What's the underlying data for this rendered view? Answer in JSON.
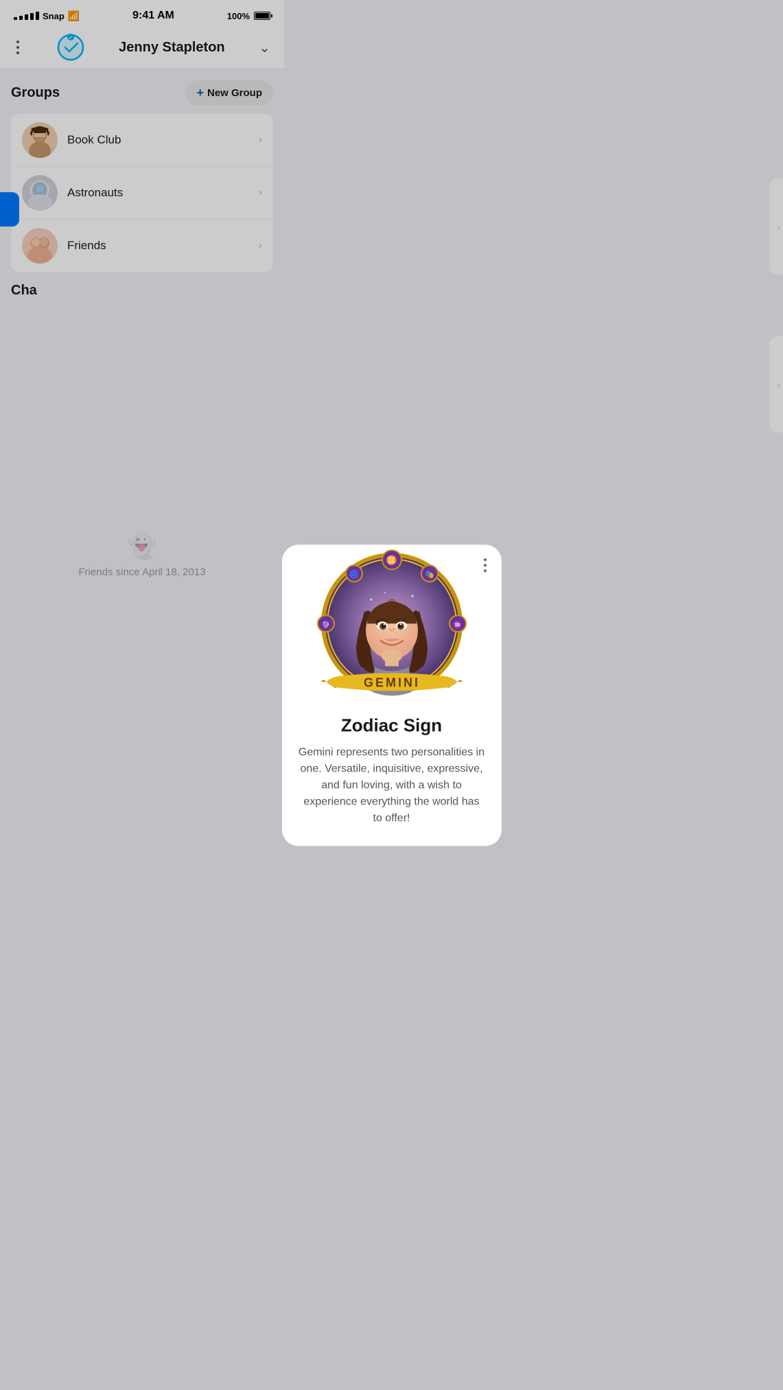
{
  "statusBar": {
    "carrier": "Snap",
    "time": "9:41 AM",
    "battery": "100%"
  },
  "header": {
    "title": "Jenny Stapleton",
    "chevron": "⌄"
  },
  "groups": {
    "sectionTitle": "Groups",
    "newGroupLabel": "New Group",
    "items": [
      {
        "name": "Book Club",
        "avatar": "person"
      },
      {
        "name": "Astronauts",
        "avatar": "astro"
      },
      {
        "name": "Friends",
        "avatar": "duo"
      }
    ]
  },
  "charms": {
    "sectionTitle": "Cha"
  },
  "modal": {
    "title": "Zodiac Sign",
    "zodiacName": "GEMINI",
    "description": "Gemini represents two personalities in one. Versatile, inquisitive, expressive, and fun loving, with a wish to experience everything the world has to offer!"
  },
  "footer": {
    "friendsSince": "Friends since April 18, 2013"
  }
}
